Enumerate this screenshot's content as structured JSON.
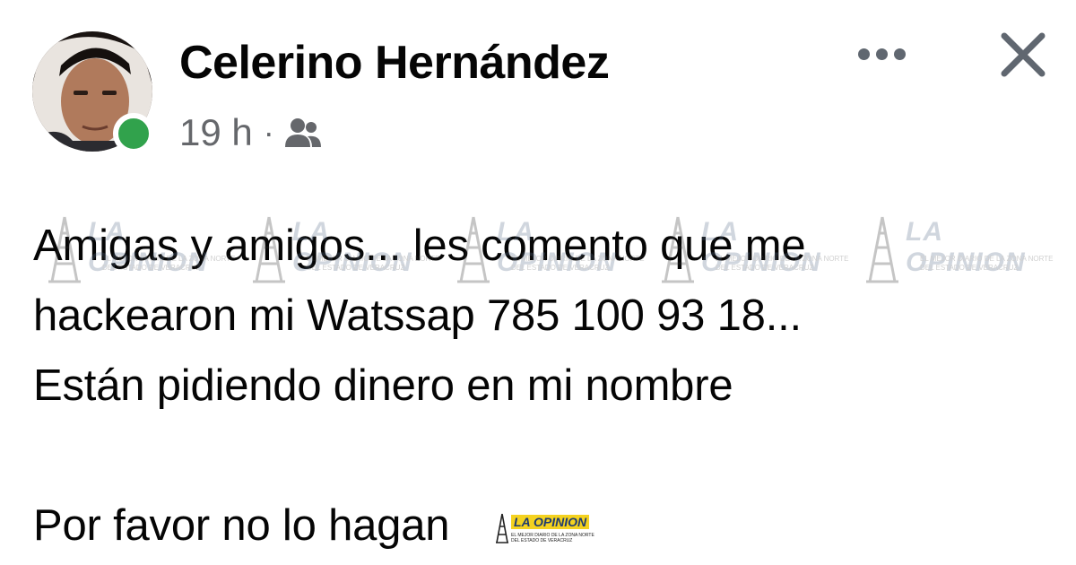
{
  "post": {
    "author": {
      "name": "Celerino Hernández",
      "online": true
    },
    "meta": {
      "time": "19 h",
      "separator": "·",
      "audience_icon": "friends-icon"
    },
    "actions": {
      "more_icon": "more-options-icon",
      "close_icon": "close-icon"
    },
    "body": {
      "lines": [
        "Amigas y amigos... les comento que me",
        "hackearon mi Watssap 785 100 93 18...",
        "Están pidiendo dinero en mi nombre",
        "",
        "Por favor no lo hagan"
      ]
    }
  },
  "watermark": {
    "brand": "LA OPINION",
    "tagline_1": "EL MEJOR DIARIO DE LA ZONA NORTE",
    "tagline_2": "DEL ESTADO DE VERACRUZ"
  },
  "colors": {
    "online": "#31a24c",
    "text": "#050505",
    "secondary_text": "#65676b",
    "logo_yellow": "#f4d21f"
  }
}
